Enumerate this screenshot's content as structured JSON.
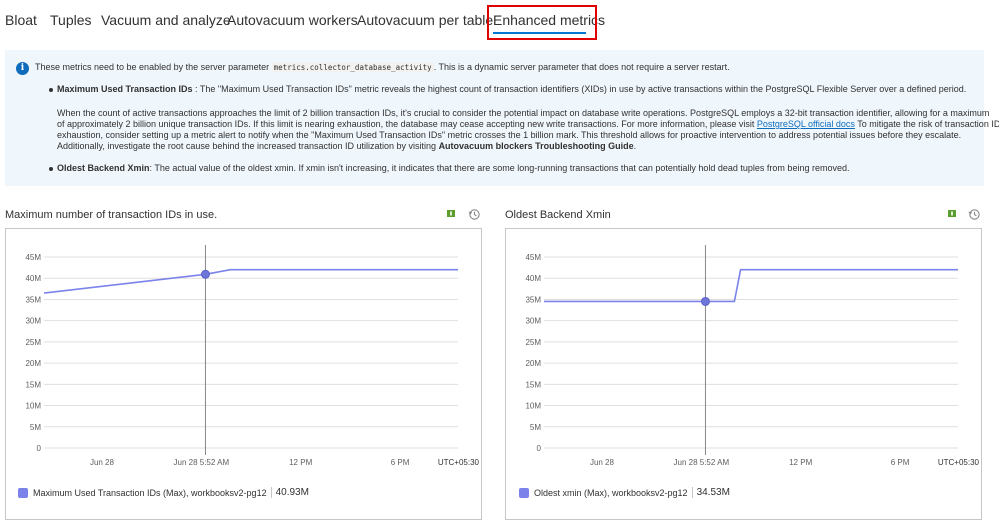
{
  "tabs": [
    {
      "label": "Bloat"
    },
    {
      "label": "Tuples"
    },
    {
      "label": "Vacuum and analyze"
    },
    {
      "label": "Autovacuum workers"
    },
    {
      "label": "Autovacuum per table"
    },
    {
      "label": "Enhanced metrics",
      "active": true
    }
  ],
  "info": {
    "intro_pre": "These metrics need to be enabled by the server parameter",
    "param": "metrics.collector_database_activity",
    "intro_post": ". This is a dynamic server parameter that does not require a server restart.",
    "b1_title": "Maximum Used Transaction IDs",
    "b1_text": " : The \"Maximum Used Transaction IDs\" metric reveals the highest count of transaction identifiers (XIDs) in use by active transactions within the PostgreSQL Flexible Server over a defined period.",
    "p1_l1": "When the count of active transactions approaches the limit of 2 billion transaction IDs, it's crucial to consider the potential impact on database write operations. PostgreSQL employs a 32-bit transaction identifier, allowing for a maximum",
    "p1_l2_pre": "of approximately 2 billion unique transaction IDs. If this limit is nearing exhaustion, the database may cease accepting new write transactions. For more information, please visit ",
    "p1_link": "PostgreSQL official docs",
    "p1_l2_post": " To mitigate the risk of transaction ID",
    "p1_l3": "exhaustion, consider setting up a metric alert to notify when the \"Maximum Used Transaction IDs\" metric crosses the 1 billion mark. This threshold allows for proactive intervention to address potential issues before they escalate.",
    "p1_l4_pre": "Additionally, investigate the root cause behind the increased transaction ID utilization by visiting ",
    "p1_l4_bold": "Autovacuum blockers Troubleshooting Guide",
    "p1_l4_post": ".",
    "b2_title": "Oldest Backend Xmin",
    "b2_text": ": The actual value of the oldest xmin. If xmin isn't increasing, it indicates that there are some long-running transactions that can potentially hold dead tuples from being removed."
  },
  "chart_data": [
    {
      "type": "line",
      "title": "Maximum number of transaction IDs in use.",
      "y_ticks": [
        "45M",
        "40M",
        "35M",
        "30M",
        "25M",
        "20M",
        "15M",
        "10M",
        "5M",
        "0"
      ],
      "ylim": [
        0,
        45000000
      ],
      "x_ticks": [
        "Jun 28",
        "Jun 28 5:52 AM",
        "12 PM",
        "6 PM"
      ],
      "timezone": "UTC+05:30",
      "series": [
        {
          "name": "Maximum Used Transaction IDs (Max), workbooksv2-pg12",
          "value_label": "40.93M",
          "color": "#7b83eb",
          "points": [
            [
              0,
              36500000
            ],
            [
              0.39,
              40930000
            ],
            [
              0.45,
              42000000
            ],
            [
              1,
              42000000
            ]
          ]
        }
      ],
      "cursor_x": 0.39,
      "cursor_y": 40930000
    },
    {
      "type": "line",
      "title": "Oldest Backend Xmin",
      "y_ticks": [
        "45M",
        "40M",
        "35M",
        "30M",
        "25M",
        "20M",
        "15M",
        "10M",
        "5M",
        "0"
      ],
      "ylim": [
        0,
        45000000
      ],
      "x_ticks": [
        "Jun 28",
        "Jun 28 5:52 AM",
        "12 PM",
        "6 PM"
      ],
      "timezone": "UTC+05:30",
      "series": [
        {
          "name": "Oldest xmin (Max), workbooksv2-pg12",
          "value_label": "34.53M",
          "color": "#7b83eb",
          "points": [
            [
              0,
              34530000
            ],
            [
              0.46,
              34530000
            ],
            [
              0.475,
              42000000
            ],
            [
              1,
              42000000
            ]
          ]
        }
      ],
      "cursor_x": 0.39,
      "cursor_y": 34530000
    }
  ]
}
